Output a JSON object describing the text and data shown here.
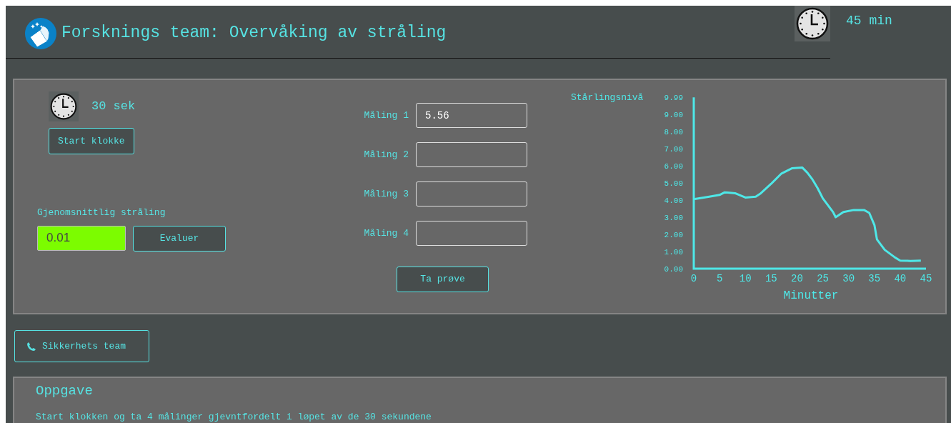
{
  "header": {
    "title": "Forsknings team: Overvåking av stråling",
    "timer": "45 min"
  },
  "panel": {
    "timer": "30 sek",
    "start_button": "Start klokke",
    "average": {
      "label": "Gjenomsnittlig stråling",
      "value": "0.01",
      "evaluate_button": "Evaluer"
    },
    "measurements": [
      {
        "label": "Måling 1",
        "value": "5.56"
      },
      {
        "label": "Måling 2"
      },
      {
        "label": "Måling 3"
      },
      {
        "label": "Måling 4"
      }
    ],
    "sample_button": "Ta prøve",
    "chart": {
      "chart_data": {
        "type": "line",
        "xlabel": "Minutter",
        "ylabel": "Stårlingsnivå",
        "x": [
          0,
          3,
          5,
          6,
          8,
          10,
          12,
          13,
          15,
          17,
          19,
          21,
          22,
          23,
          24,
          25,
          27,
          27.5,
          29,
          31,
          33,
          34,
          35,
          35.5,
          37,
          39,
          40,
          42,
          44
        ],
        "series": [
          {
            "color": "#4ee8e8",
            "values": [
              4.05,
              4.2,
              4.3,
              4.45,
              4.4,
              4.15,
              4.2,
              4.4,
              4.95,
              5.55,
              5.85,
              5.9,
              5.6,
              5.2,
              4.7,
              4.1,
              3.3,
              3.0,
              3.3,
              3.42,
              3.42,
              3.25,
              2.55,
              1.7,
              1.1,
              0.65,
              0.47,
              0.45,
              0.47
            ]
          }
        ],
        "xlim": [
          0,
          45
        ],
        "ylim": [
          0,
          9.99
        ],
        "xticks": [
          0,
          5,
          10,
          15,
          20,
          25,
          30,
          35,
          40,
          45
        ],
        "yticks": [
          {
            "value": 0,
            "label": "0.00"
          },
          {
            "value": 1,
            "label": "1.00"
          },
          {
            "value": 2,
            "label": "2.00"
          },
          {
            "value": 3,
            "label": "3.00"
          },
          {
            "value": 4,
            "label": "4.00"
          },
          {
            "value": 5,
            "label": "5.00"
          },
          {
            "value": 6,
            "label": "6.00"
          },
          {
            "value": 7,
            "label": "7.00"
          },
          {
            "value": 8,
            "label": "8.00"
          },
          {
            "value": 9,
            "label": "9.00"
          },
          {
            "value": 9.99,
            "label": "9.99"
          }
        ]
      }
    }
  },
  "safety_button": "Sikkerhets team",
  "task": {
    "title": "Oppgave",
    "text": "Start klokken og ta 4 målinger gjevntfordelt i løpet av de 30 sekundene"
  }
}
